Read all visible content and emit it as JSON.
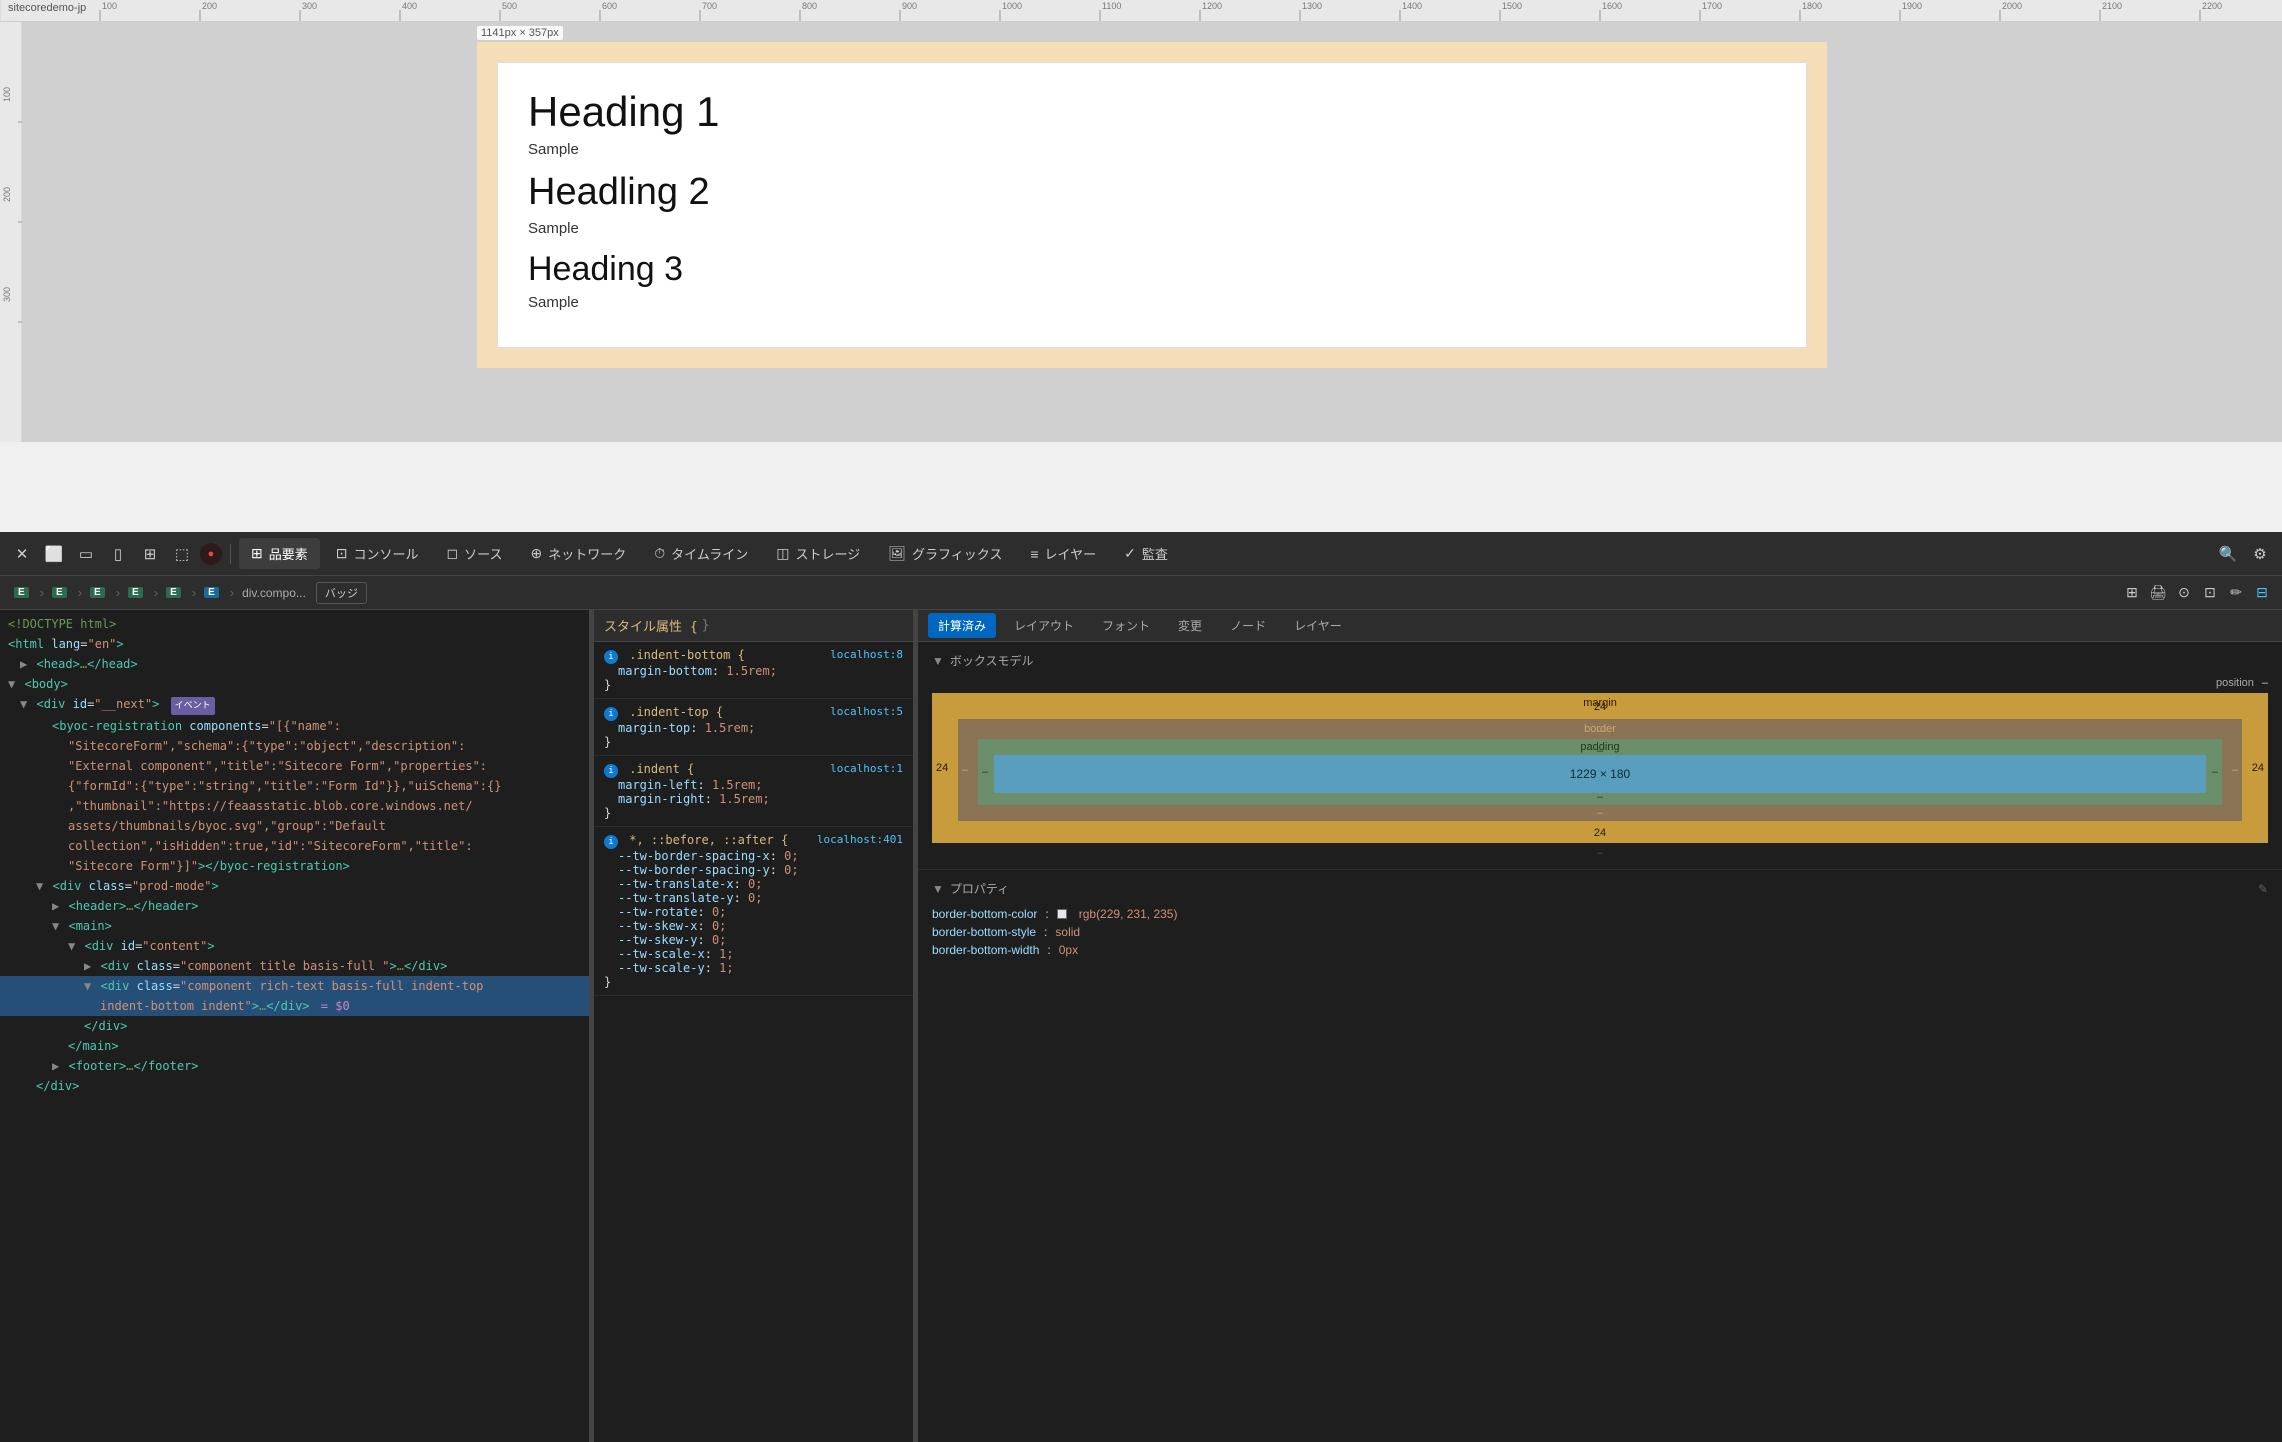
{
  "ruler": {
    "site_label": "sitecoredemo-jp",
    "size_label": "1141px × 357px",
    "ticks": [
      "100",
      "200",
      "300",
      "400",
      "500",
      "600",
      "700",
      "800",
      "900",
      "1000",
      "1100"
    ]
  },
  "viewport": {
    "headings": [
      {
        "level": "h1",
        "text": "Heading 1"
      },
      {
        "level": "p",
        "text": "Sample"
      },
      {
        "level": "h2",
        "text": "Headling 2"
      },
      {
        "level": "p",
        "text": "Sample"
      },
      {
        "level": "h3",
        "text": "Heading 3"
      },
      {
        "level": "p",
        "text": "Sample"
      }
    ]
  },
  "devtools": {
    "toolbar": {
      "tabs": [
        {
          "label": "品要素",
          "icon": "□"
        },
        {
          "label": "コンソール",
          "icon": ">"
        },
        {
          "label": "ソース",
          "icon": "◻"
        },
        {
          "label": "ネットワーク",
          "icon": "⊕"
        },
        {
          "label": "タイムライン",
          "icon": "⏱"
        },
        {
          "label": "ストレージ",
          "icon": "🗄"
        },
        {
          "label": "グラフィックス",
          "icon": "🖼"
        },
        {
          "label": "レイヤー",
          "icon": "≡"
        },
        {
          "label": "監査",
          "icon": "✓"
        }
      ]
    },
    "breadcrumb": {
      "items": [
        "E",
        "E",
        "E",
        "E",
        "E",
        "E"
      ],
      "last_item": "div.compo..."
    },
    "html_panel": {
      "lines": [
        {
          "indent": 0,
          "text": "<!DOCTYPE html>"
        },
        {
          "indent": 0,
          "text": "<html lang=\"en\">"
        },
        {
          "indent": 0,
          "text": "  <head>…</head>"
        },
        {
          "indent": 0,
          "text": "▼ <body>"
        },
        {
          "indent": 1,
          "text": "▼ <div id=\"__next\"> イベント"
        },
        {
          "indent": 2,
          "text": "<byoc-registration components=\"[{\"name\":"
        },
        {
          "indent": 3,
          "text": "\"SitecoreForm\",\"schema\":{\"type\":\"object\",\"description\":"
        },
        {
          "indent": 3,
          "text": "\"External component\",\"title\":\"Sitecore Form\",\"properties\":"
        },
        {
          "indent": 3,
          "text": "{\"formId\":{\"type\":\"string\",\"title\":\"Form Id\"}}},\"uiSchema\":{}"
        },
        {
          "indent": 3,
          "text": ",\"thumbnail\":\"https://feaasstatic.blob.core.windows.net/"
        },
        {
          "indent": 3,
          "text": "assets/thumbnails/byoc.svg\",\"group\":\"Default"
        },
        {
          "indent": 3,
          "text": "collection\",\"isHidden\":true,\"id\":\"SitecoreForm\",\"title\":"
        },
        {
          "indent": 3,
          "text": "\"Sitecore Form\"}]\"></byoc-registration>"
        },
        {
          "indent": 2,
          "text": "▼ <div class=\"prod-mode\">"
        },
        {
          "indent": 3,
          "text": "▶ <header>…</header>"
        },
        {
          "indent": 3,
          "text": "▼ <main>"
        },
        {
          "indent": 4,
          "text": "▼ <div id=\"content\">"
        },
        {
          "indent": 5,
          "text": "▶ <div class=\"component title basis-full \">…</div>"
        },
        {
          "indent": 5,
          "text": "▼ <div class=\"component rich-text basis-full indent-top",
          "selected": true
        },
        {
          "indent": 5,
          "text": "   indent-bottom indent\">…</div>  = $0",
          "selected": true
        },
        {
          "indent": 4,
          "text": "   </div>"
        },
        {
          "indent": 3,
          "text": "</main>"
        },
        {
          "indent": 2,
          "text": "▶ <footer>…</footer>"
        },
        {
          "indent": 1,
          "text": "</div>"
        }
      ]
    },
    "css_panel": {
      "header": "スタイル属性 {",
      "rules": [
        {
          "selector": ".indent-bottom {",
          "source": "localhost:8",
          "properties": [
            {
              "prop": "margin-bottom",
              "val": "1.5rem;"
            }
          ]
        },
        {
          "selector": ".indent-top {",
          "source": "localhost:5",
          "properties": [
            {
              "prop": "margin-top",
              "val": "1.5rem;"
            }
          ]
        },
        {
          "selector": ".indent {",
          "source": "localhost:1",
          "properties": [
            {
              "prop": "margin-left",
              "val": "1.5rem;"
            },
            {
              "prop": "margin-right",
              "val": "1.5rem;"
            }
          ]
        },
        {
          "selector": "*, ::before, ::after {",
          "source": "localhost:401",
          "properties": [
            {
              "prop": "--tw-border-spacing-x",
              "val": "0;"
            },
            {
              "prop": "--tw-border-spacing-y",
              "val": "0;"
            },
            {
              "prop": "--tw-translate-x",
              "val": "0;"
            },
            {
              "prop": "--tw-translate-y",
              "val": "0;"
            },
            {
              "prop": "--tw-rotate",
              "val": "0;"
            },
            {
              "prop": "--tw-skew-x",
              "val": "0;"
            },
            {
              "prop": "--tw-skew-y",
              "val": "0;"
            },
            {
              "prop": "--tw-scale-x",
              "val": "1;"
            },
            {
              "prop": "--tw-scale-y",
              "val": "1;"
            }
          ]
        }
      ]
    },
    "right_panel": {
      "tabs": [
        "計算済み",
        "レイアウト",
        "フォント",
        "変更",
        "ノード",
        "レイヤー"
      ],
      "active_tab": "計算済み",
      "box_model": {
        "title": "ボックスモデル",
        "position": "–",
        "margin": {
          "top": "24",
          "right": "24",
          "bottom": "24",
          "left": "24",
          "label": "margin"
        },
        "border": {
          "top": "–",
          "right": "–",
          "bottom": "–",
          "left": "–",
          "label": "border"
        },
        "padding": {
          "top": "–",
          "right": "–",
          "bottom": "–",
          "left": "–",
          "label": "padding"
        },
        "content": {
          "width": "1229",
          "height": "180",
          "label": "1229 × 180"
        }
      },
      "properties": {
        "title": "プロパティ",
        "items": [
          {
            "key": "border-bottom-color",
            "val": "rgb(229, 231, 235)",
            "color_swatch": "#e5e7eb"
          },
          {
            "key": "border-bottom-style",
            "val": "solid"
          },
          {
            "key": "border-bottom-width",
            "val": "0px"
          }
        ]
      }
    }
  }
}
